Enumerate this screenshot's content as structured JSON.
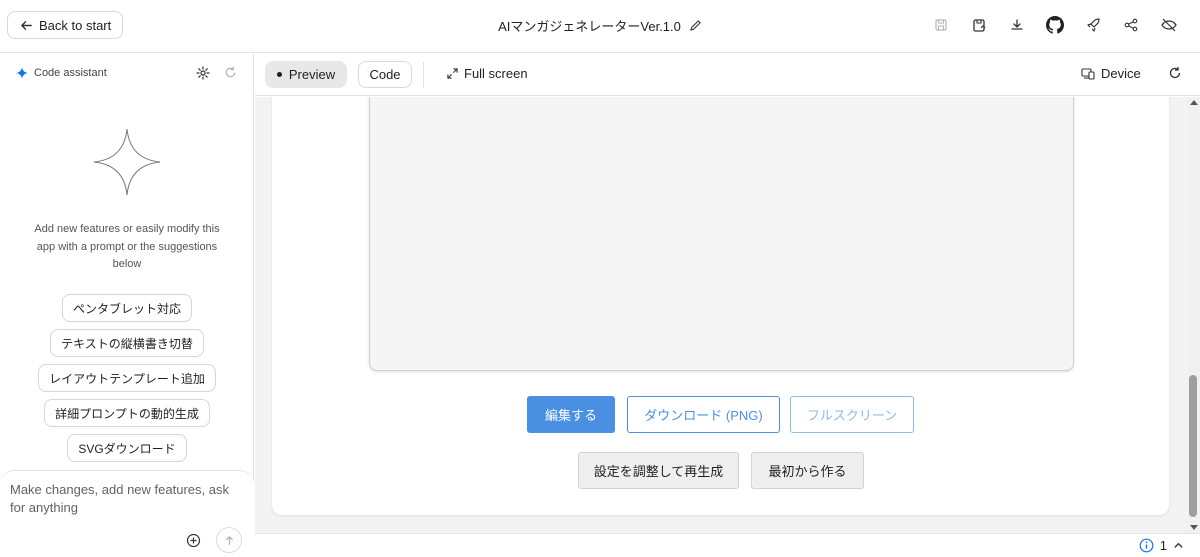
{
  "header": {
    "back_label": "Back to start",
    "app_title": "AIマンガジェネレーターVer.1.0",
    "icons": [
      "save-icon",
      "save-as-icon",
      "download-icon",
      "github-icon",
      "deploy-rocket-icon",
      "share-icon",
      "hide-icon"
    ]
  },
  "assistant": {
    "label": "Code assistant",
    "intro": "Add new features or easily modify this app with a prompt or the suggestions below",
    "suggestions": [
      "ペンタブレット対応",
      "テキストの縦横書き切替",
      "レイアウトテンプレート追加",
      "詳細プロンプトの動的生成",
      "SVGダウンロード"
    ],
    "prompt_placeholder": "Make changes, add new features, ask for anything"
  },
  "toolbar": {
    "preview_label": "Preview",
    "code_label": "Code",
    "fullscreen_label": "Full screen",
    "device_label": "Device"
  },
  "app": {
    "edit_button": "編集する",
    "download_button": "ダウンロード (PNG)",
    "fullscreen_button": "フルスクリーン",
    "regenerate_button": "設定を調整して再生成",
    "restart_button": "最初から作る"
  },
  "status": {
    "issue_count": "1"
  },
  "colors": {
    "primary_blue": "#4a90e2",
    "sparkle_blue": "#1a73e8"
  }
}
